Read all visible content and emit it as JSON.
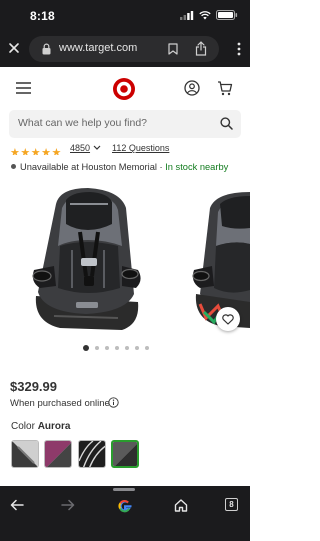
{
  "status_bar": {
    "time": "8:18"
  },
  "browser": {
    "url": "www.target.com"
  },
  "search": {
    "placeholder": "What can we help you find?"
  },
  "product": {
    "rating_stars": "★★★★★",
    "review_count": "4850",
    "questions_link": "112 Questions",
    "availability": "Unavailable at Houston Memorial",
    "availability_sep": " · ",
    "in_stock": "In stock nearby",
    "price": "$329.99",
    "price_note": "When purchased online",
    "color_label": "Color",
    "color_selected": "Aurora",
    "gallery_slide": 1,
    "gallery_count": 7
  },
  "colors": {
    "accent_green": "#2a9d2e",
    "in_stock_green": "#137c1f",
    "target_red": "#cc0000"
  },
  "icons": [
    "close-icon",
    "lock-icon",
    "bookmark-icon",
    "share-icon",
    "more-icon",
    "hamburger-icon",
    "target-logo",
    "account-icon",
    "cart-icon",
    "search-icon",
    "heart-icon",
    "info-icon",
    "back-arrow-icon",
    "forward-arrow-icon",
    "google-icon",
    "home-icon",
    "tabs-icon"
  ],
  "bottom_nav": {
    "tabs_count": "8"
  }
}
